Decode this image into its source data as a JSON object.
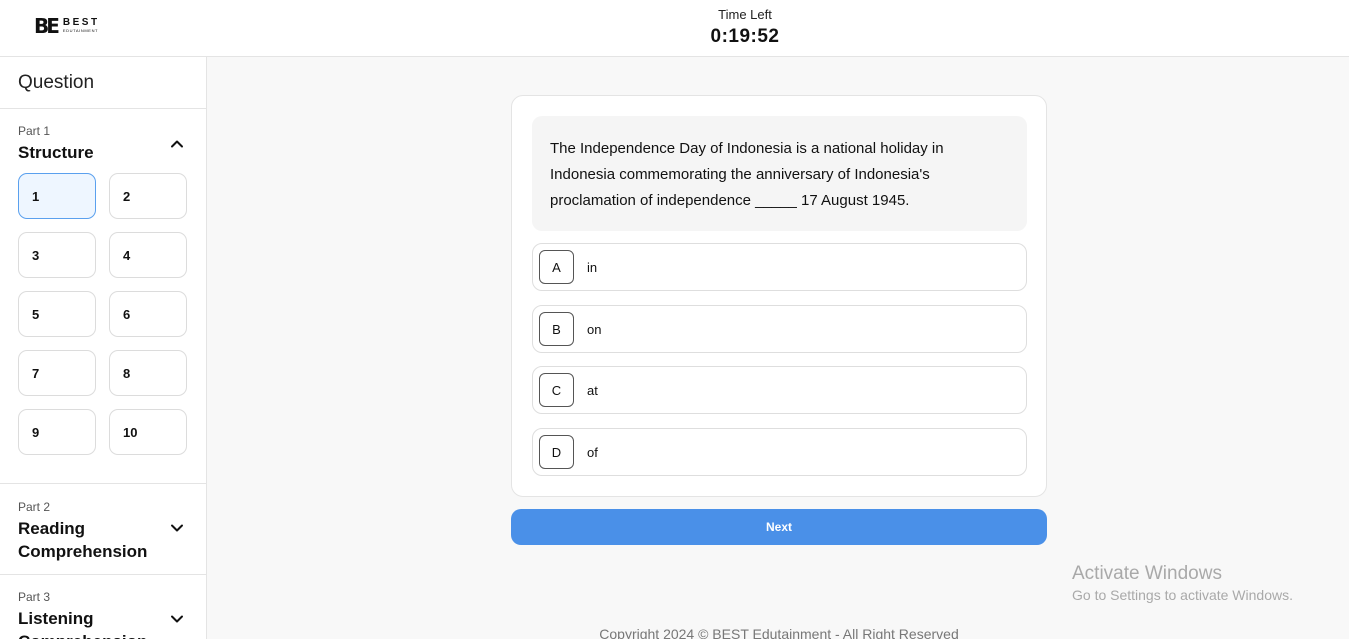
{
  "brand": {
    "mark": "BE",
    "name": "BEST",
    "sub": "EDUTAINMENT",
    "tagline": ""
  },
  "timer": {
    "label": "Time Left",
    "value": "0:19:52"
  },
  "sidebar": {
    "title": "Question",
    "parts": [
      {
        "label": "Part 1",
        "name": "Structure",
        "expanded": true,
        "chevron_icon": "chevron-up-icon"
      },
      {
        "label": "Part 2",
        "name": "Reading Comprehension",
        "expanded": false,
        "chevron_icon": "chevron-down-icon"
      },
      {
        "label": "Part 3",
        "name": "Listening Comprehension",
        "expanded": false,
        "chevron_icon": "chevron-down-icon"
      }
    ],
    "questions": [
      "1",
      "2",
      "3",
      "4",
      "5",
      "6",
      "7",
      "8",
      "9",
      "10"
    ],
    "active_question": "1"
  },
  "question": {
    "text": "The Independence Day of Indonesia is a national holiday in Indonesia commemorating the anniversary of Indonesia's proclamation of independence _____ 17 August 1945.",
    "options": [
      {
        "letter": "A",
        "text": "in"
      },
      {
        "letter": "B",
        "text": "on"
      },
      {
        "letter": "C",
        "text": "at"
      },
      {
        "letter": "D",
        "text": "of"
      }
    ]
  },
  "next_label": "Next",
  "footer": "Copyright 2024 © BEST Edutainment - All Right Reserved",
  "watermark": {
    "title": "Activate Windows",
    "subtitle": "Go to Settings to activate Windows."
  },
  "colors": {
    "accent": "#4a90e8",
    "active_bg": "#eef6ff",
    "active_border": "#5aa0ee",
    "page_bg": "#f8f8f8"
  }
}
